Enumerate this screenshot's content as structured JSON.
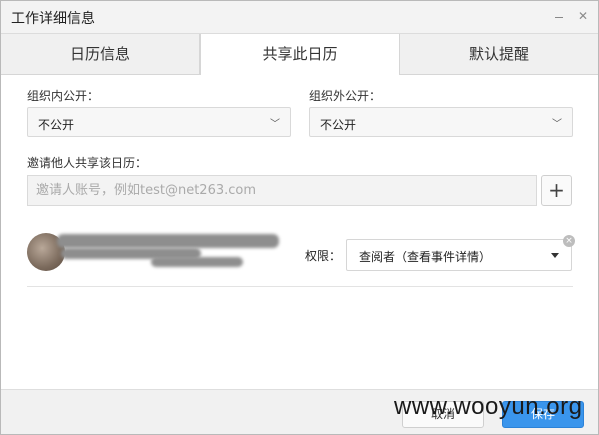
{
  "window": {
    "title": "工作详细信息",
    "minimize_icon": "minimize-icon",
    "close_icon": "close-icon",
    "close_glyph": "✕"
  },
  "tabs": [
    {
      "label": "日历信息",
      "active": false
    },
    {
      "label": "共享此日历",
      "active": true
    },
    {
      "label": "默认提醒",
      "active": false
    }
  ],
  "org_internal": {
    "label": "组织内公开：",
    "value": "不公开"
  },
  "org_external": {
    "label": "组织外公开：",
    "value": "不公开"
  },
  "invite": {
    "label": "邀请他人共享该日历：",
    "placeholder": "邀请人账号，例如test@net263.com",
    "add_glyph": "+"
  },
  "share_entry": {
    "permission_label": "权限：",
    "permission_value": "查阅者（查看事件详情）",
    "remove_glyph": "×"
  },
  "footer": {
    "cancel_label": "取消",
    "save_label": "保存"
  },
  "watermark": "www.wooyun.org",
  "colors": {
    "accent": "#3a95ec",
    "tab_bg": "#f0f0f0"
  }
}
